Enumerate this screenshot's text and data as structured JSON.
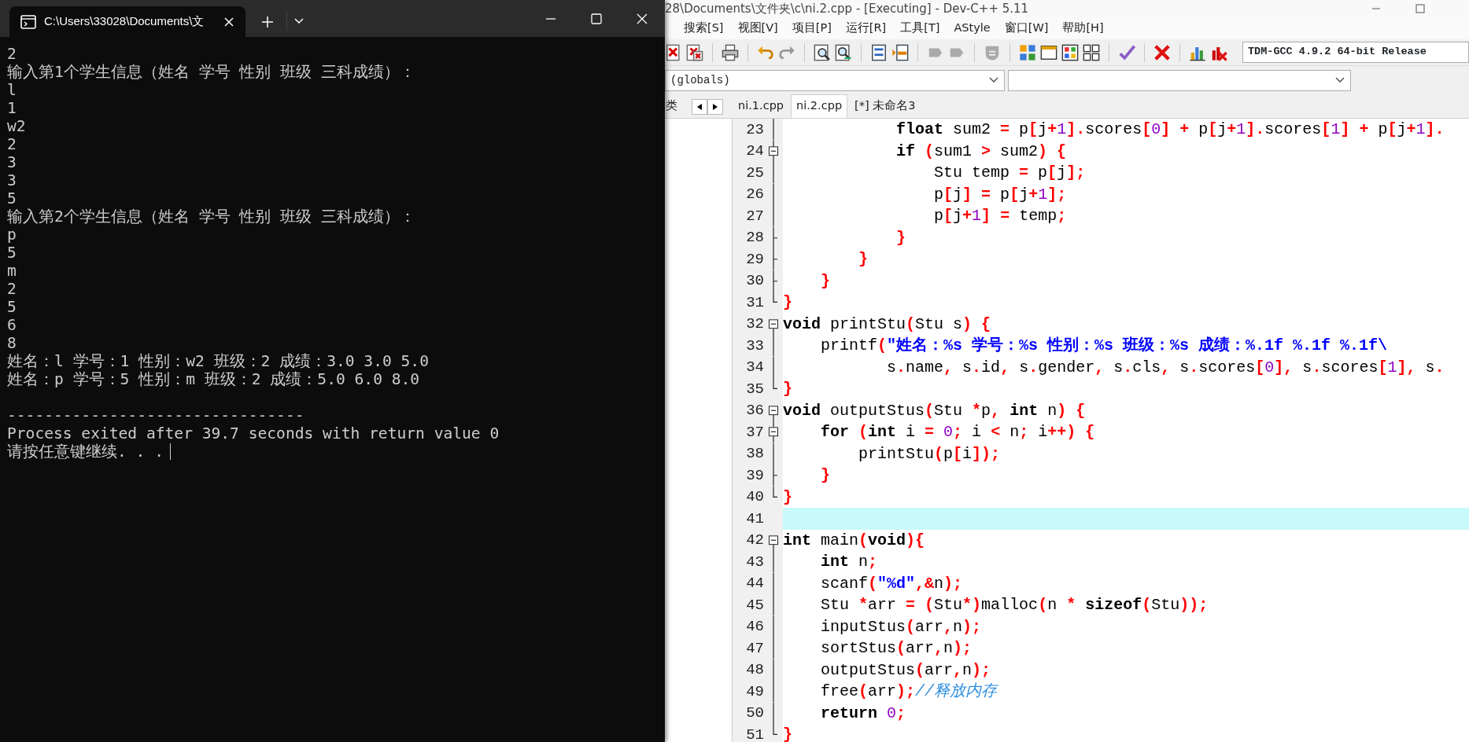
{
  "terminal": {
    "tab_title": "C:\\Users\\33028\\Documents\\文",
    "lines": [
      {
        "text": "2"
      },
      {
        "text": "输入第1个学生信息（姓名 学号 性别 班级 三科成绩）："
      },
      {
        "text": "l"
      },
      {
        "text": "1"
      },
      {
        "text": "w2"
      },
      {
        "text": "2"
      },
      {
        "text": "3"
      },
      {
        "text": "3"
      },
      {
        "text": "5"
      },
      {
        "text": "输入第2个学生信息（姓名 学号 性别 班级 三科成绩）："
      },
      {
        "text": "p"
      },
      {
        "text": "5"
      },
      {
        "text": "m"
      },
      {
        "text": "2"
      },
      {
        "text": "5"
      },
      {
        "text": "6"
      },
      {
        "text": "8"
      },
      {
        "text": "姓名：l 学号：1 性别：w2 班级：2 成绩：3.0 3.0 5.0"
      },
      {
        "text": "姓名：p 学号：5 性别：m 班级：2 成绩：5.0 6.0 8.0"
      },
      {
        "text": "--------------------------------",
        "blank_line_before": true
      },
      {
        "text": "Process exited after 39.7 seconds with return value 0"
      },
      {
        "text": "请按任意键继续. . .",
        "cursor": true
      }
    ]
  },
  "ide": {
    "title": "28\\Documents\\文件夹\\c\\ni.2.cpp - [Executing] - Dev-C++ 5.11",
    "menu": [
      "搜索[S]",
      "视图[V]",
      "项目[P]",
      "运行[R]",
      "工具[T]",
      "AStyle",
      "窗口[W]",
      "帮助[H]"
    ],
    "compiler": "TDM-GCC 4.9.2 64-bit Release",
    "scope": "(globals)",
    "class_tab": "类",
    "tabs": [
      {
        "label": "ni.1.cpp",
        "selected": false
      },
      {
        "label": "ni.2.cpp",
        "selected": true
      },
      {
        "label": "[*] 未命名3",
        "selected": false
      }
    ],
    "lines": [
      {
        "number": "23",
        "kind": "line",
        "current": false,
        "tokens": [
          {
            "kind": "kw",
            "text": "            float"
          },
          {
            "kind": "id",
            "text": " sum2 "
          },
          {
            "kind": "op",
            "text": "="
          },
          {
            "kind": "id",
            "text": " p"
          },
          {
            "kind": "op",
            "text": "["
          },
          {
            "kind": "id",
            "text": "j"
          },
          {
            "kind": "op",
            "text": "+"
          },
          {
            "kind": "num",
            "text": "1"
          },
          {
            "kind": "op",
            "text": "]."
          },
          {
            "kind": "id",
            "text": "scores"
          },
          {
            "kind": "op",
            "text": "["
          },
          {
            "kind": "num",
            "text": "0"
          },
          {
            "kind": "op",
            "text": "]"
          },
          {
            "kind": "op",
            "text": " +"
          },
          {
            "kind": "id",
            "text": " p"
          },
          {
            "kind": "op",
            "text": "["
          },
          {
            "kind": "id",
            "text": "j"
          },
          {
            "kind": "op",
            "text": "+"
          },
          {
            "kind": "num",
            "text": "1"
          },
          {
            "kind": "op",
            "text": "]."
          },
          {
            "kind": "id",
            "text": "scores"
          },
          {
            "kind": "op",
            "text": "["
          },
          {
            "kind": "num",
            "text": "1"
          },
          {
            "kind": "op",
            "text": "]"
          },
          {
            "kind": "op",
            "text": " +"
          },
          {
            "kind": "id",
            "text": " p"
          },
          {
            "kind": "op",
            "text": "["
          },
          {
            "kind": "id",
            "text": "j"
          },
          {
            "kind": "op",
            "text": "+"
          },
          {
            "kind": "num",
            "text": "1"
          },
          {
            "kind": "op",
            "text": "]."
          }
        ]
      },
      {
        "number": "24",
        "kind": "open",
        "current": false,
        "tokens": [
          {
            "kind": "kw",
            "text": "            if"
          },
          {
            "kind": "op",
            "text": " ("
          },
          {
            "kind": "id",
            "text": "sum1 "
          },
          {
            "kind": "op",
            "text": ">"
          },
          {
            "kind": "id",
            "text": " sum2"
          },
          {
            "kind": "op",
            "text": ")"
          },
          {
            "kind": "op",
            "text": " {"
          }
        ]
      },
      {
        "number": "25",
        "kind": "line",
        "current": false,
        "tokens": [
          {
            "kind": "id",
            "text": "                Stu temp "
          },
          {
            "kind": "op",
            "text": "="
          },
          {
            "kind": "id",
            "text": " p"
          },
          {
            "kind": "op",
            "text": "["
          },
          {
            "kind": "id",
            "text": "j"
          },
          {
            "kind": "op",
            "text": "];"
          }
        ]
      },
      {
        "number": "26",
        "kind": "line",
        "current": false,
        "tokens": [
          {
            "kind": "id",
            "text": "                p"
          },
          {
            "kind": "op",
            "text": "["
          },
          {
            "kind": "id",
            "text": "j"
          },
          {
            "kind": "op",
            "text": "]"
          },
          {
            "kind": "op",
            "text": " ="
          },
          {
            "kind": "id",
            "text": " p"
          },
          {
            "kind": "op",
            "text": "["
          },
          {
            "kind": "id",
            "text": "j"
          },
          {
            "kind": "op",
            "text": "+"
          },
          {
            "kind": "num",
            "text": "1"
          },
          {
            "kind": "op",
            "text": "];"
          }
        ]
      },
      {
        "number": "27",
        "kind": "line",
        "current": false,
        "tokens": [
          {
            "kind": "id",
            "text": "                p"
          },
          {
            "kind": "op",
            "text": "["
          },
          {
            "kind": "id",
            "text": "j"
          },
          {
            "kind": "op",
            "text": "+"
          },
          {
            "kind": "num",
            "text": "1"
          },
          {
            "kind": "op",
            "text": "]"
          },
          {
            "kind": "op",
            "text": " ="
          },
          {
            "kind": "id",
            "text": " temp"
          },
          {
            "kind": "op",
            "text": ";"
          }
        ]
      },
      {
        "number": "28",
        "kind": "mid",
        "current": false,
        "tokens": [
          {
            "kind": "op",
            "text": "            }"
          }
        ]
      },
      {
        "number": "29",
        "kind": "mid",
        "current": false,
        "tokens": [
          {
            "kind": "op",
            "text": "        }"
          }
        ]
      },
      {
        "number": "30",
        "kind": "mid",
        "current": false,
        "tokens": [
          {
            "kind": "op",
            "text": "    }"
          }
        ]
      },
      {
        "number": "31",
        "kind": "end",
        "current": false,
        "tokens": [
          {
            "kind": "op",
            "text": "}"
          }
        ]
      },
      {
        "number": "32",
        "kind": "start",
        "current": false,
        "tokens": [
          {
            "kind": "kw",
            "text": "void"
          },
          {
            "kind": "id",
            "text": " printStu"
          },
          {
            "kind": "op",
            "text": "("
          },
          {
            "kind": "id",
            "text": "Stu s"
          },
          {
            "kind": "op",
            "text": ")"
          },
          {
            "kind": "op",
            "text": " {"
          }
        ]
      },
      {
        "number": "33",
        "kind": "line",
        "current": false,
        "tokens": [
          {
            "kind": "id",
            "text": "    printf"
          },
          {
            "kind": "op",
            "text": "("
          },
          {
            "kind": "str",
            "text": "\"姓名：%s 学号：%s 性别：%s 班级：%s 成绩：%.1f %.1f %.1f\\"
          }
        ]
      },
      {
        "number": "34",
        "kind": "line",
        "current": false,
        "tokens": [
          {
            "kind": "id",
            "text": "           s"
          },
          {
            "kind": "op",
            "text": "."
          },
          {
            "kind": "id",
            "text": "name"
          },
          {
            "kind": "op",
            "text": ","
          },
          {
            "kind": "id",
            "text": " s"
          },
          {
            "kind": "op",
            "text": "."
          },
          {
            "kind": "id",
            "text": "id"
          },
          {
            "kind": "op",
            "text": ","
          },
          {
            "kind": "id",
            "text": " s"
          },
          {
            "kind": "op",
            "text": "."
          },
          {
            "kind": "id",
            "text": "gender"
          },
          {
            "kind": "op",
            "text": ","
          },
          {
            "kind": "id",
            "text": " s"
          },
          {
            "kind": "op",
            "text": "."
          },
          {
            "kind": "id",
            "text": "cls"
          },
          {
            "kind": "op",
            "text": ","
          },
          {
            "kind": "id",
            "text": " s"
          },
          {
            "kind": "op",
            "text": "."
          },
          {
            "kind": "id",
            "text": "scores"
          },
          {
            "kind": "op",
            "text": "["
          },
          {
            "kind": "num",
            "text": "0"
          },
          {
            "kind": "op",
            "text": "],"
          },
          {
            "kind": "id",
            "text": " s"
          },
          {
            "kind": "op",
            "text": "."
          },
          {
            "kind": "id",
            "text": "scores"
          },
          {
            "kind": "op",
            "text": "["
          },
          {
            "kind": "num",
            "text": "1"
          },
          {
            "kind": "op",
            "text": "],"
          },
          {
            "kind": "id",
            "text": " s"
          },
          {
            "kind": "op",
            "text": "."
          }
        ]
      },
      {
        "number": "35",
        "kind": "end",
        "current": false,
        "tokens": [
          {
            "kind": "op",
            "text": "}"
          }
        ]
      },
      {
        "number": "36",
        "kind": "start",
        "current": false,
        "tokens": [
          {
            "kind": "kw",
            "text": "void"
          },
          {
            "kind": "id",
            "text": " outputStus"
          },
          {
            "kind": "op",
            "text": "("
          },
          {
            "kind": "id",
            "text": "Stu "
          },
          {
            "kind": "op",
            "text": "*"
          },
          {
            "kind": "id",
            "text": "p"
          },
          {
            "kind": "op",
            "text": ","
          },
          {
            "kind": "kw",
            "text": " int"
          },
          {
            "kind": "id",
            "text": " n"
          },
          {
            "kind": "op",
            "text": ")"
          },
          {
            "kind": "op",
            "text": " {"
          }
        ]
      },
      {
        "number": "37",
        "kind": "open",
        "current": false,
        "tokens": [
          {
            "kind": "kw",
            "text": "    for"
          },
          {
            "kind": "op",
            "text": " ("
          },
          {
            "kind": "kw",
            "text": "int"
          },
          {
            "kind": "id",
            "text": " i "
          },
          {
            "kind": "op",
            "text": "="
          },
          {
            "kind": "num",
            "text": " 0"
          },
          {
            "kind": "op",
            "text": ";"
          },
          {
            "kind": "id",
            "text": " i "
          },
          {
            "kind": "op",
            "text": "<"
          },
          {
            "kind": "id",
            "text": " n"
          },
          {
            "kind": "op",
            "text": ";"
          },
          {
            "kind": "id",
            "text": " i"
          },
          {
            "kind": "op",
            "text": "++)"
          },
          {
            "kind": "op",
            "text": " {"
          }
        ]
      },
      {
        "number": "38",
        "kind": "line",
        "current": false,
        "tokens": [
          {
            "kind": "id",
            "text": "        printStu"
          },
          {
            "kind": "op",
            "text": "("
          },
          {
            "kind": "id",
            "text": "p"
          },
          {
            "kind": "op",
            "text": "["
          },
          {
            "kind": "id",
            "text": "i"
          },
          {
            "kind": "op",
            "text": "]);"
          }
        ]
      },
      {
        "number": "39",
        "kind": "mid",
        "current": false,
        "tokens": [
          {
            "kind": "op",
            "text": "    }"
          }
        ]
      },
      {
        "number": "40",
        "kind": "end",
        "current": false,
        "tokens": [
          {
            "kind": "op",
            "text": "}"
          }
        ]
      },
      {
        "number": "41",
        "kind": "none",
        "current": true
      },
      {
        "number": "42",
        "kind": "start",
        "current": false,
        "tokens": [
          {
            "kind": "kw",
            "text": "int"
          },
          {
            "kind": "id",
            "text": " main"
          },
          {
            "kind": "op",
            "text": "("
          },
          {
            "kind": "kw",
            "text": "void"
          },
          {
            "kind": "op",
            "text": "){"
          }
        ]
      },
      {
        "number": "43",
        "kind": "line",
        "current": false,
        "tokens": [
          {
            "kind": "kw",
            "text": "    int"
          },
          {
            "kind": "id",
            "text": " n"
          },
          {
            "kind": "op",
            "text": ";"
          }
        ]
      },
      {
        "number": "44",
        "kind": "line",
        "current": false,
        "tokens": [
          {
            "kind": "id",
            "text": "    scanf"
          },
          {
            "kind": "op",
            "text": "("
          },
          {
            "kind": "str",
            "text": "\"%d\""
          },
          {
            "kind": "op",
            "text": ",&"
          },
          {
            "kind": "id",
            "text": "n"
          },
          {
            "kind": "op",
            "text": ");"
          }
        ]
      },
      {
        "number": "45",
        "kind": "line",
        "current": false,
        "tokens": [
          {
            "kind": "id",
            "text": "    Stu "
          },
          {
            "kind": "op",
            "text": "*"
          },
          {
            "kind": "id",
            "text": "arr "
          },
          {
            "kind": "op",
            "text": "="
          },
          {
            "kind": "op",
            "text": " ("
          },
          {
            "kind": "id",
            "text": "Stu"
          },
          {
            "kind": "op",
            "text": "*)"
          },
          {
            "kind": "id",
            "text": "malloc"
          },
          {
            "kind": "op",
            "text": "("
          },
          {
            "kind": "id",
            "text": "n "
          },
          {
            "kind": "op",
            "text": "*"
          },
          {
            "kind": "kw",
            "text": " sizeof"
          },
          {
            "kind": "op",
            "text": "("
          },
          {
            "kind": "id",
            "text": "Stu"
          },
          {
            "kind": "op",
            "text": "));"
          }
        ]
      },
      {
        "number": "46",
        "kind": "line",
        "current": false,
        "tokens": [
          {
            "kind": "id",
            "text": "    inputStus"
          },
          {
            "kind": "op",
            "text": "("
          },
          {
            "kind": "id",
            "text": "arr"
          },
          {
            "kind": "op",
            "text": ","
          },
          {
            "kind": "id",
            "text": "n"
          },
          {
            "kind": "op",
            "text": ");"
          }
        ]
      },
      {
        "number": "47",
        "kind": "line",
        "current": false,
        "tokens": [
          {
            "kind": "id",
            "text": "    sortStus"
          },
          {
            "kind": "op",
            "text": "("
          },
          {
            "kind": "id",
            "text": "arr"
          },
          {
            "kind": "op",
            "text": ","
          },
          {
            "kind": "id",
            "text": "n"
          },
          {
            "kind": "op",
            "text": ");"
          }
        ]
      },
      {
        "number": "48",
        "kind": "line",
        "current": false,
        "tokens": [
          {
            "kind": "id",
            "text": "    outputStus"
          },
          {
            "kind": "op",
            "text": "("
          },
          {
            "kind": "id",
            "text": "arr"
          },
          {
            "kind": "op",
            "text": ","
          },
          {
            "kind": "id",
            "text": "n"
          },
          {
            "kind": "op",
            "text": ");"
          }
        ]
      },
      {
        "number": "49",
        "kind": "line",
        "current": false,
        "tokens": [
          {
            "kind": "id",
            "text": "    free"
          },
          {
            "kind": "op",
            "text": "("
          },
          {
            "kind": "id",
            "text": "arr"
          },
          {
            "kind": "op",
            "text": ");"
          },
          {
            "kind": "cm",
            "text": "//释放内存"
          }
        ]
      },
      {
        "number": "50",
        "kind": "line",
        "current": false,
        "tokens": [
          {
            "kind": "kw",
            "text": "    return"
          },
          {
            "kind": "num",
            "text": " 0"
          },
          {
            "kind": "op",
            "text": ";"
          }
        ]
      },
      {
        "number": "51",
        "kind": "end",
        "current": false,
        "tokens": [
          {
            "kind": "op",
            "text": "}"
          }
        ]
      }
    ]
  }
}
